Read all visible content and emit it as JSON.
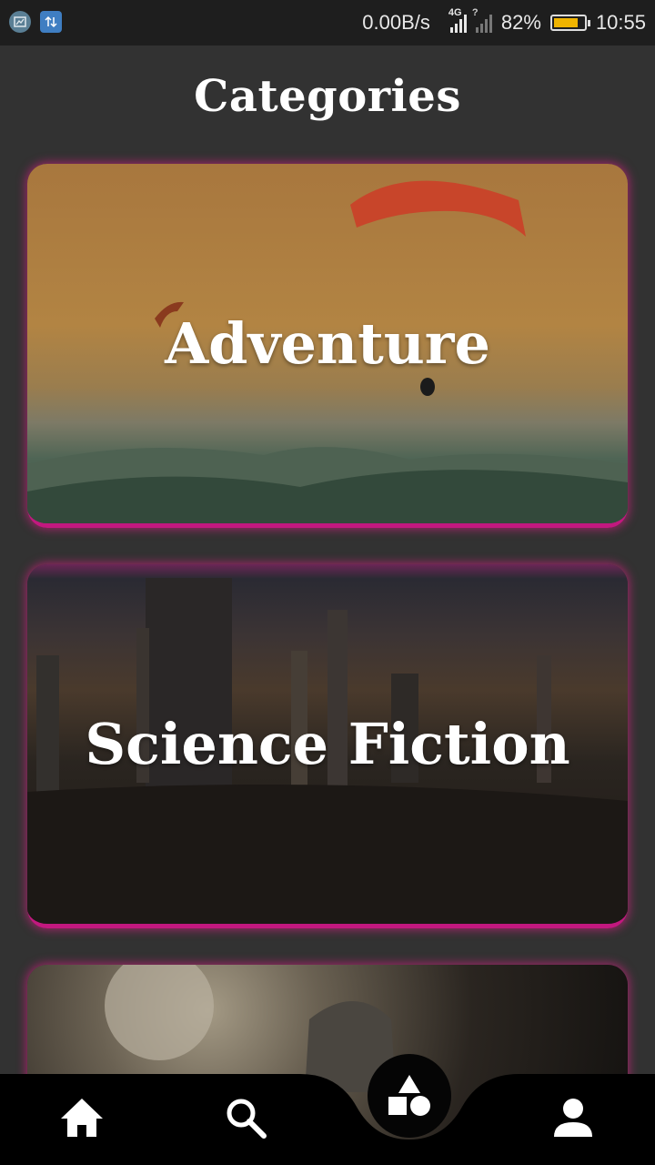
{
  "status_bar": {
    "network_speed": "0.00B/s",
    "network_type": "4G",
    "sim2_indicator": "?",
    "battery_percent": "82%",
    "battery_level": 0.82,
    "time": "10:55"
  },
  "header": {
    "title": "Categories"
  },
  "categories": [
    {
      "label": "Adventure"
    },
    {
      "label": "Science Fiction"
    },
    {
      "label": ""
    }
  ],
  "bottom_nav": {
    "items": [
      {
        "icon": "home-icon"
      },
      {
        "icon": "search-icon"
      },
      {
        "icon": "categories-shapes-icon",
        "active": true
      },
      {
        "icon": "profile-icon"
      }
    ]
  },
  "colors": {
    "background": "#323232",
    "card_glow": "#e91e8c",
    "navbar": "#000000"
  }
}
